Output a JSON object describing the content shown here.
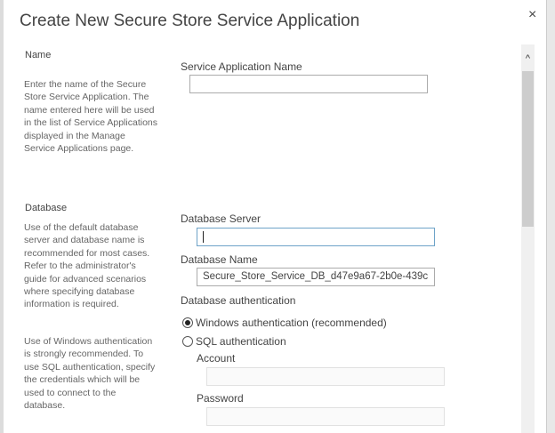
{
  "dialog": {
    "title": "Create New Secure Store Service Application",
    "close_label": "×"
  },
  "scrollbar": {
    "up_arrow": "^",
    "position": 0.0
  },
  "name_section": {
    "heading": "Name",
    "description": "Enter the name of the Secure Store Service Application. The name entered here will be used in the list of Service Applications displayed in the Manage Service Applications page.",
    "field_label": "Service Application Name",
    "field_value": ""
  },
  "database_section": {
    "heading": "Database",
    "description1": "Use of the default database server and database name is recommended for most cases. Refer to the administrator's guide for advanced scenarios where specifying database information is required.",
    "description2": "Use of Windows authentication is strongly recommended. To use SQL authentication, specify the credentials which will be used to connect to the database.",
    "server_label": "Database Server",
    "server_value": "",
    "name_label": "Database Name",
    "name_value": "Secure_Store_Service_DB_d47e9a67-2b0e-439c",
    "auth_label": "Database authentication",
    "auth_options": [
      {
        "label": "Windows authentication (recommended)",
        "selected": true
      },
      {
        "label": "SQL authentication",
        "selected": false
      }
    ],
    "account_label": "Account",
    "account_value": "",
    "password_label": "Password",
    "password_value": ""
  }
}
